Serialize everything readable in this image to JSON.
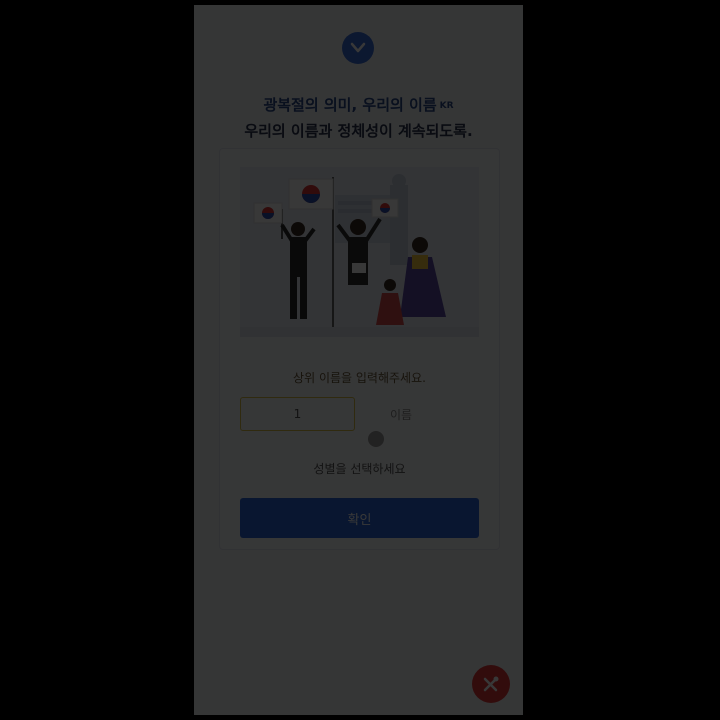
{
  "header": {
    "line1": "광복절의 의미, 우리의 이름",
    "line1_sup": "KR",
    "line2": "우리의 이름과 정체성이 계속되도록."
  },
  "form": {
    "prompt": "상위 이름을 입력해주세요.",
    "name_input_value": "1",
    "name_placeholder": "이름",
    "gender_label": "성별을 선택하세요",
    "confirm_label": "확인"
  },
  "icons": {
    "logo": "chevron-down-icon",
    "fab": "tools-icon",
    "illustration": "independence-celebration-illustration"
  },
  "colors": {
    "brand_blue": "#2c66d8",
    "fab_red": "#e23a3a",
    "input_border": "#d8c046"
  }
}
